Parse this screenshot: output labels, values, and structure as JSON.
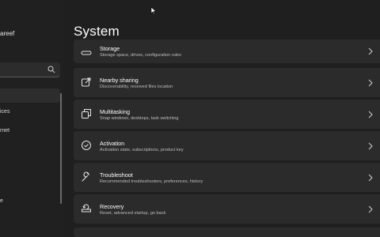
{
  "sidebar": {
    "user_name": "areef",
    "items": [
      {
        "label": "ices"
      },
      {
        "label": "rnet"
      },
      {
        "label": "e"
      }
    ]
  },
  "header": {
    "title": "System"
  },
  "settings": [
    {
      "title": "Storage",
      "desc": "Storage space, drives, configuration rules",
      "icon": "storage-icon"
    },
    {
      "title": "Nearby sharing",
      "desc": "Discoverability, received files location",
      "icon": "share-icon"
    },
    {
      "title": "Multitasking",
      "desc": "Snap windows, desktops, task switching",
      "icon": "multitasking-icon"
    },
    {
      "title": "Activation",
      "desc": "Activation state, subscriptions, product key",
      "icon": "check-circle-icon"
    },
    {
      "title": "Troubleshoot",
      "desc": "Recommended troubleshooters, preferences, history",
      "icon": "wrench-icon"
    },
    {
      "title": "Recovery",
      "desc": "Reset, advanced startup, go back",
      "icon": "recovery-icon"
    }
  ],
  "colors": {
    "background": "#1f1f1f",
    "card": "#2b2b2b",
    "text": "#ffffff",
    "subtext": "#bdbdbd"
  }
}
